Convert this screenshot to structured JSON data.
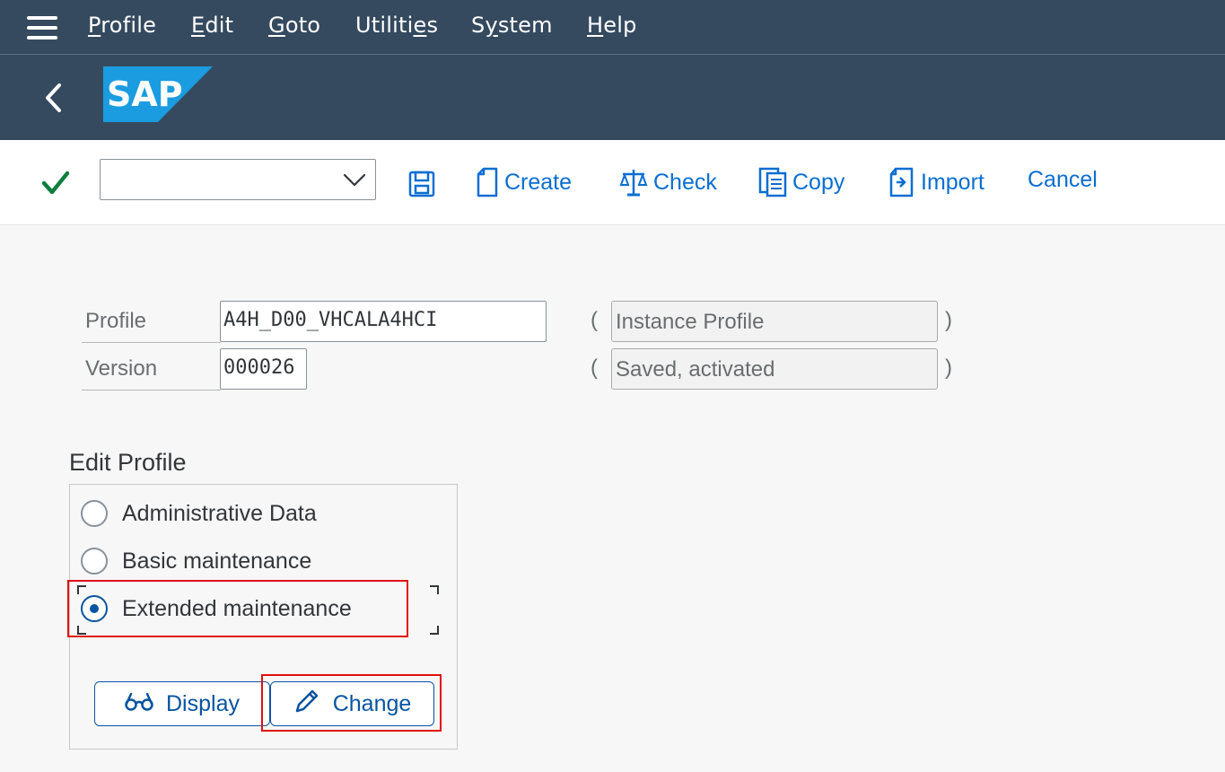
{
  "menubar": {
    "items": [
      {
        "mnemonic": "P",
        "rest": "rofile"
      },
      {
        "mnemonic": "E",
        "rest": "dit"
      },
      {
        "mnemonic": "G",
        "rest": "oto"
      },
      {
        "pre": "Utiliti",
        "mnemonic": "e",
        "rest": "s"
      },
      {
        "pre": "S",
        "mnemonic": "y",
        "rest": "stem"
      },
      {
        "mnemonic": "H",
        "rest": "elp"
      }
    ]
  },
  "header": {
    "logo_text": "SAP",
    "logo_color": "#1b9ce0"
  },
  "toolbar": {
    "command_field": {
      "value": "",
      "placeholder": ""
    },
    "create_label": "Create",
    "check_label": "Check",
    "copy_label": "Copy",
    "import_label": "Import",
    "cancel_label": "Cancel",
    "accent_color": "#0a6ed1",
    "ok_color": "#107e3e"
  },
  "form": {
    "profile_label": "Profile",
    "profile_value": "A4H_D00_VHCALA4HCI",
    "profile_type": "Instance Profile",
    "version_label": "Version",
    "version_value": "000026",
    "version_status": "Saved, activated",
    "open_paren": "(",
    "close_paren": ")"
  },
  "edit_profile": {
    "title": "Edit Profile",
    "options": [
      {
        "label": "Administrative Data",
        "selected": false
      },
      {
        "label": "Basic maintenance",
        "selected": false
      },
      {
        "label": "Extended maintenance",
        "selected": true
      }
    ],
    "display_label": "Display",
    "change_label": "Change"
  },
  "annotations": {
    "highlight_color": "#e10f0f"
  }
}
